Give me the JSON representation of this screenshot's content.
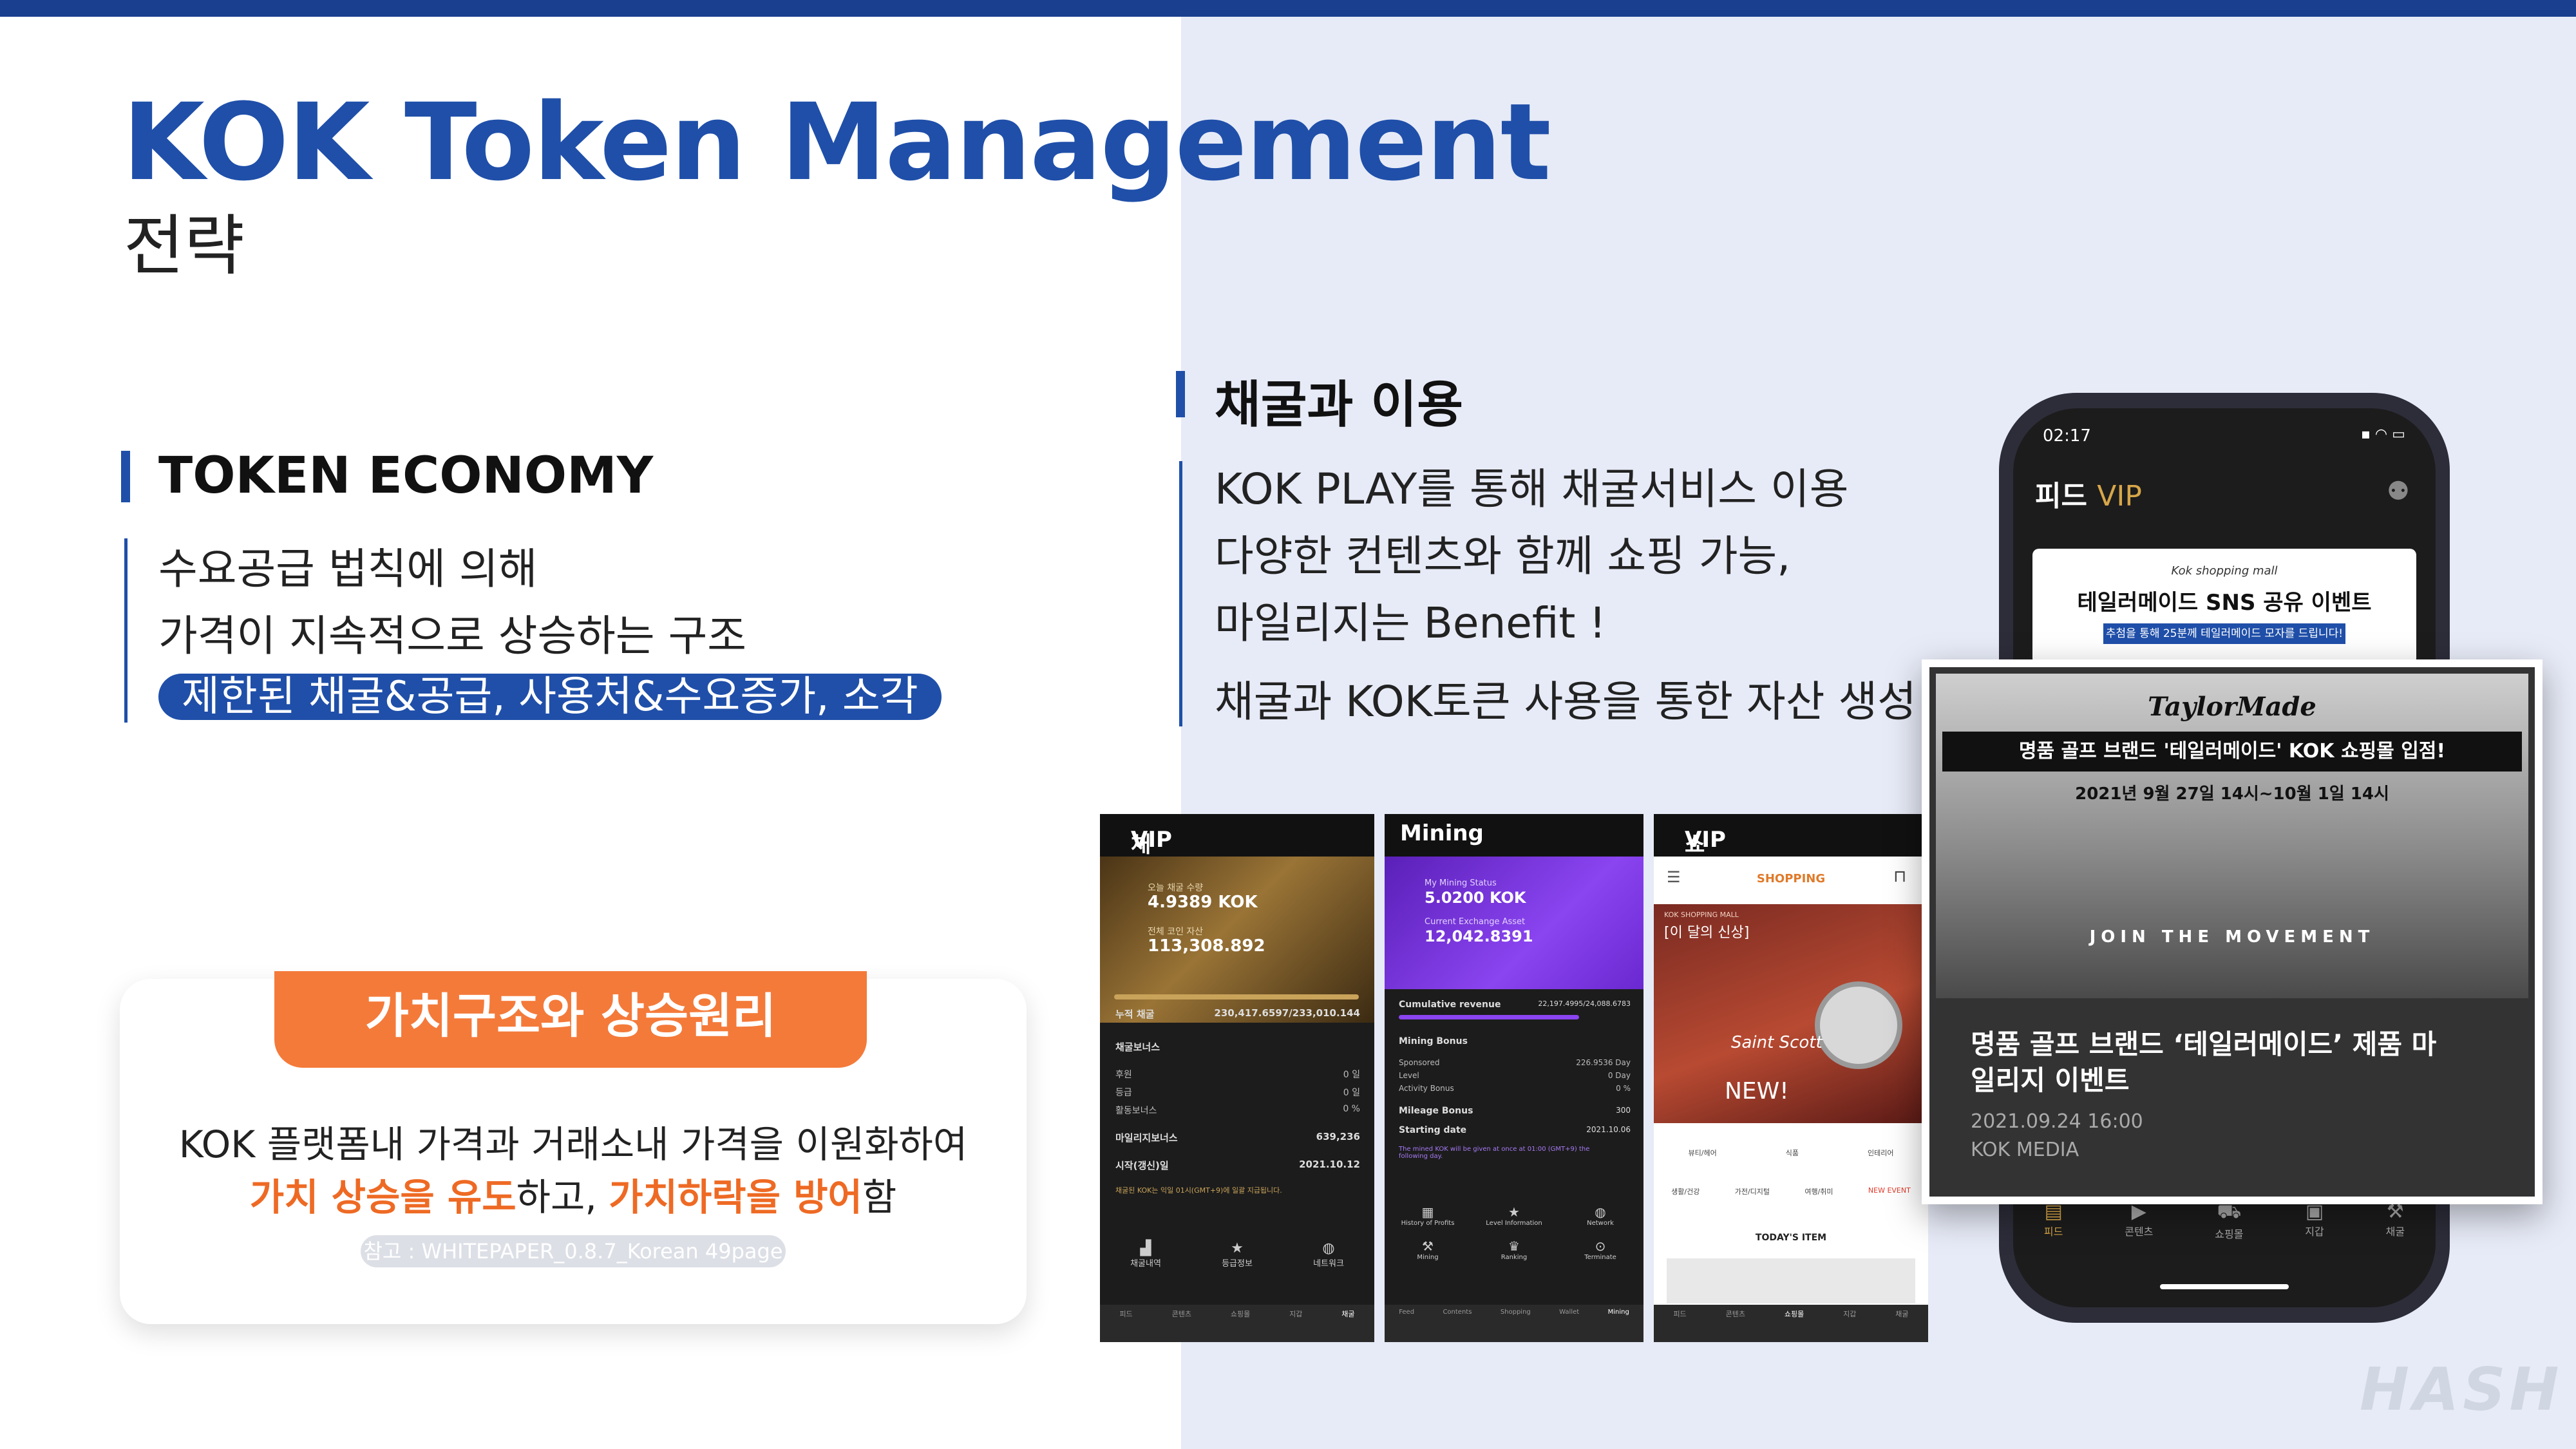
{
  "header": {
    "title": "KOK Token Management",
    "subtitle": "전략"
  },
  "token_economy": {
    "heading": "TOKEN ECONOMY",
    "line1": "수요공급 법칙에 의해",
    "line2": "가격이 지속적으로 상승하는 구조",
    "highlight": "제한된 채굴&공급, 사용처&수요증가, 소각"
  },
  "value_card": {
    "tab": "가치구조와 상승원리",
    "line1": "KOK 플랫폼내 가격과 거래소내 가격을 이원화하여",
    "line2_a": "가치 상승을 유도",
    "line2_b": "하고, ",
    "line2_c": "가치하락을 방어",
    "line2_d": "함",
    "ref": "참고 : WHITEPAPER_0.8.7_Korean 49page"
  },
  "mining_use": {
    "heading": "채굴과 이용",
    "line1": "KOK PLAY를 통해 채굴서비스 이용",
    "line2": "다양한 컨텐츠와 함께 쇼핑 가능,",
    "line3": "마일리지는 Benefit !",
    "line4": "채굴과 KOK토큰 사용을 통한 자산 생성"
  },
  "screen1": {
    "title": "채굴",
    "vip": "VIP",
    "label_today": "오늘 채굴 수량",
    "today": "4.9389 KOK",
    "label_total": "전체 코인 자산",
    "total": "113,308.892",
    "rows": [
      [
        "누적 채굴",
        "230,417.6597/233,010.144"
      ],
      [
        "채굴보너스",
        ""
      ],
      [
        "후원",
        "0 일"
      ],
      [
        "등급",
        "0 일"
      ],
      [
        "활동보너스",
        "0 %"
      ],
      [
        "마일리지보너스",
        "639,236"
      ],
      [
        "시작(갱신)일",
        "2021.10.12"
      ]
    ],
    "notice": "채굴된 KOK는 익일 01시(GMT+9)에 일괄 지급됩니다.",
    "nav": [
      "채굴내역",
      "등급정보",
      "네트워크"
    ],
    "tabs": [
      "피드",
      "콘텐츠",
      "쇼핑몰",
      "지갑",
      "채굴"
    ]
  },
  "screen2": {
    "title": "Mining",
    "label_status": "My Mining Status",
    "status": "5.0200 KOK",
    "label_asset": "Current Exchange Asset",
    "asset": "12,042.8391",
    "rows": [
      [
        "Cumulative revenue",
        "22,197.4995/24,088.6783"
      ],
      [
        "Mining Bonus",
        ""
      ],
      [
        "Sponsored",
        "226.9536 Day"
      ],
      [
        "Level",
        "0 Day"
      ],
      [
        "Activity Bonus",
        "0 %"
      ],
      [
        "Mileage Bonus",
        "300"
      ],
      [
        "Starting date",
        "2021.10.06"
      ]
    ],
    "notice": "The mined KOK will be given at once at 01:00 (GMT+9) the following day.",
    "nav": [
      "History of Profits",
      "Level Information",
      "Network",
      "Mining",
      "Ranking",
      "Terminate"
    ],
    "tabs": [
      "Feed",
      "Contents",
      "Shopping",
      "Wallet",
      "Mining"
    ]
  },
  "screen3": {
    "title": "쇼핑몰",
    "vip": "VIP",
    "shop": "SHOPPING",
    "banner_small": "KOK SHOPPING MALL",
    "banner_big": "[이 달의 신상]",
    "brand": "Saint Scott",
    "new": "NEW!",
    "cats": [
      "뷰티/헤어",
      "식품",
      "인테리어"
    ],
    "cats2": [
      "생활/건강",
      "가전/디지털",
      "여행/취미",
      "NEW EVENT"
    ],
    "today": "TODAY'S ITEM",
    "tabs": [
      "피드",
      "콘텐츠",
      "쇼핑몰",
      "지갑",
      "채굴"
    ]
  },
  "phone": {
    "time": "02:17",
    "title": "피드",
    "vip": "VIP",
    "event_small": "Kok shopping mall",
    "event_title": "테일러메이드 SNS 공유 이벤트",
    "event_sub": "추첨을 통해 25분께 테일러메이드 모자를 드립니다!",
    "tabs": [
      "피드",
      "콘텐츠",
      "쇼핑몰",
      "지갑",
      "채굴"
    ]
  },
  "popup": {
    "logo": "TaylorMade",
    "banner": "명품 골프 브랜드 '테일러메이드' KOK 쇼핑몰 입점!",
    "dates": "2021년 9월 27일 14시~10월 1일 14시",
    "movement": "JOIN THE MOVEMENT",
    "headline1": "명품 골프 브랜드 ‘테일러메이드’ 제품 마",
    "headline2": "일리지 이벤트",
    "date": "2021.09.24 16:00",
    "source": "KOK MEDIA"
  },
  "watermark": "HASH",
  "colors": {
    "primary": "#1f4fa9",
    "orange": "#f47a3a",
    "purple": "#7a30e0",
    "gold": "#d7a64a"
  }
}
